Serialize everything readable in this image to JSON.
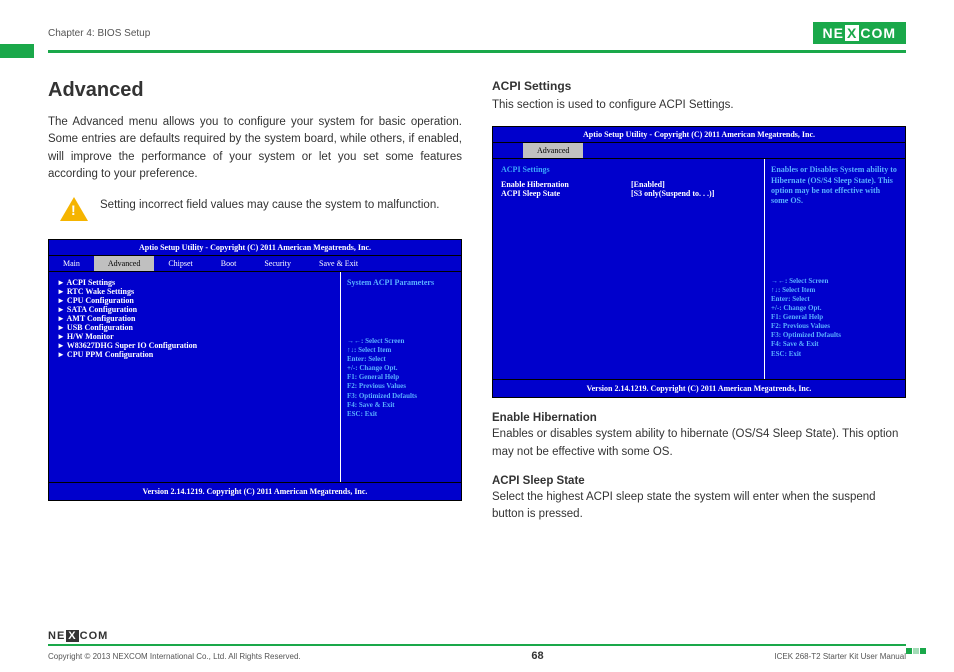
{
  "header": {
    "chapter": "Chapter 4: BIOS Setup",
    "brand_pre": "NE",
    "brand_x": "X",
    "brand_post": "COM"
  },
  "left": {
    "h1": "Advanced",
    "intro": "The Advanced menu allows you to configure your system for basic operation. Some entries are defaults required by the system board, while others, if enabled, will improve the performance of your system or let you set some features according to your preference.",
    "warn": "Setting incorrect field values may cause the system to malfunction.",
    "bios": {
      "title": "Aptio Setup Utility - Copyright (C) 2011 American Megatrends, Inc.",
      "tabs": [
        "Main",
        "Advanced",
        "Chipset",
        "Boot",
        "Security",
        "Save & Exit"
      ],
      "active_tab": "Advanced",
      "items": [
        "ACPI Settings",
        "RTC Wake Settings",
        "CPU Configuration",
        "SATA Configuration",
        "AMT Configuration",
        "USB Configuration",
        "H/W Monitor",
        "W83627DHG Super IO Configuration",
        "CPU PPM Configuration"
      ],
      "help": "System ACPI Parameters",
      "keys": [
        "→←: Select Screen",
        "↑↓: Select Item",
        "Enter: Select",
        "+/-: Change Opt.",
        "F1: General Help",
        "F2: Previous Values",
        "F3: Optimized Defaults",
        "F4: Save & Exit",
        "ESC: Exit"
      ],
      "version": "Version 2.14.1219. Copyright (C) 2011 American Megatrends, Inc."
    }
  },
  "right": {
    "h3": "ACPI Settings",
    "intro": "This section is used to configure ACPI Settings.",
    "bios": {
      "title": "Aptio Setup Utility - Copyright (C) 2011 American Megatrends, Inc.",
      "tab": "Advanced",
      "section": "ACPI Settings",
      "rows": [
        {
          "lbl": "Enable Hibernation",
          "val": "[Enabled]"
        },
        {
          "lbl": "ACPI Sleep State",
          "val": "[S3 only(Suspend to. . .)]"
        }
      ],
      "help": "Enables or Disables System ability to Hibernate (OS/S4 Sleep State). This option may be not effective with some OS.",
      "keys": [
        "→←: Select Screen",
        "↑↓: Select Item",
        "Enter: Select",
        "+/-: Change Opt.",
        "F1: General Help",
        "F2: Previous Values",
        "F3: Optimized Defaults",
        "F4: Save & Exit",
        "ESC: Exit"
      ],
      "version": "Version 2.14.1219. Copyright (C) 2011 American Megatrends, Inc."
    },
    "sub1_h": "Enable Hibernation",
    "sub1_t": "Enables or disables system ability to hibernate (OS/S4 Sleep State). This option may not be effective with some OS.",
    "sub2_h": "ACPI Sleep State",
    "sub2_t": "Select the highest ACPI sleep state the system will enter when the suspend button is pressed."
  },
  "footer": {
    "copyright": "Copyright © 2013 NEXCOM International Co., Ltd. All Rights Reserved.",
    "page": "68",
    "doc": "ICEK 268-T2 Starter Kit User Manual"
  }
}
